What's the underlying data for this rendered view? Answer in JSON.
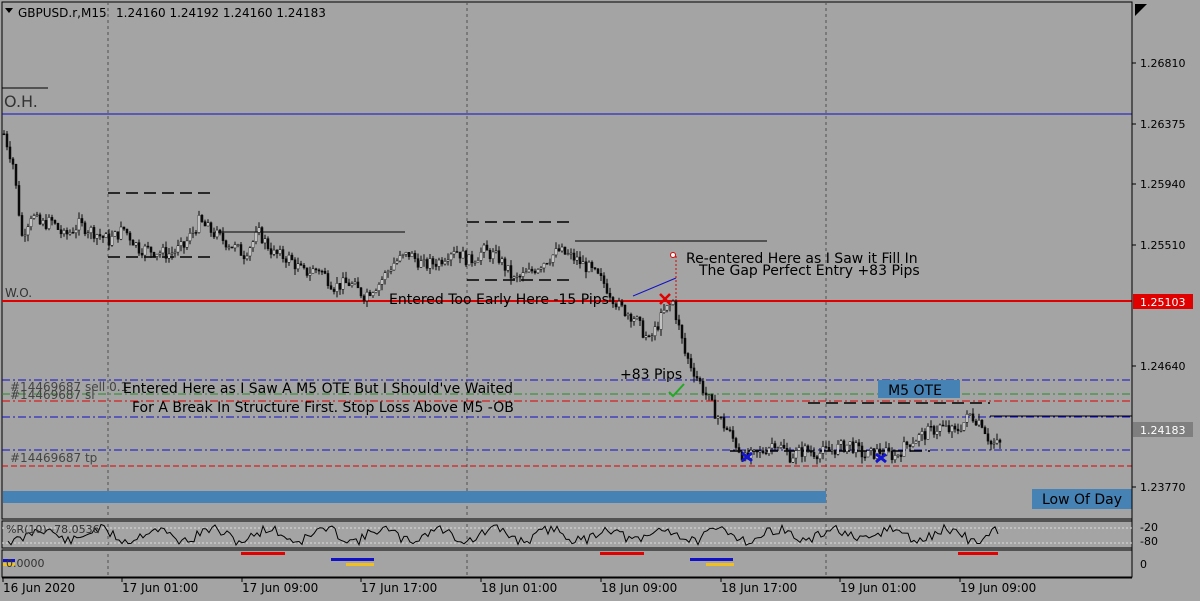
{
  "header": {
    "symbol": "GBPUSD.r,M15",
    "ohlc": "1.24160 1.24192 1.24160 1.24183"
  },
  "chart_data": {
    "type": "candlestick",
    "ylim": [
      1.2367,
      1.272
    ],
    "price_ticks": [
      "1.26810",
      "1.26375",
      "1.25940",
      "1.25510",
      "1.25103",
      "1.24640",
      "1.24183",
      "1.23770"
    ],
    "x_ticks": [
      "16 Jun 2020",
      "17 Jun 01:00",
      "17 Jun 09:00",
      "17 Jun 17:00",
      "18 Jun 01:00",
      "18 Jun 09:00",
      "18 Jun 17:00",
      "19 Jun 01:00",
      "19 Jun 09:00"
    ],
    "current_price": "1.24183",
    "marked_price": "1.25103",
    "close_path": [
      [
        0,
        1.263
      ],
      [
        3,
        1.261
      ],
      [
        6,
        1.256
      ],
      [
        9,
        1.2575
      ],
      [
        12,
        1.2568
      ],
      [
        16,
        1.257
      ],
      [
        20,
        1.256
      ],
      [
        25,
        1.2568
      ],
      [
        30,
        1.2563
      ],
      [
        35,
        1.2557
      ],
      [
        40,
        1.2565
      ],
      [
        45,
        1.2552
      ],
      [
        50,
        1.255
      ],
      [
        55,
        1.2548
      ],
      [
        60,
        1.2553
      ],
      [
        65,
        1.257
      ],
      [
        70,
        1.2562
      ],
      [
        75,
        1.2555
      ],
      [
        80,
        1.2548
      ],
      [
        85,
        1.2562
      ],
      [
        90,
        1.2548
      ],
      [
        95,
        1.2545
      ],
      [
        100,
        1.2535
      ],
      [
        105,
        1.2538
      ],
      [
        110,
        1.2526
      ],
      [
        115,
        1.2528
      ],
      [
        120,
        1.252
      ],
      [
        125,
        1.2528
      ],
      [
        130,
        1.2542
      ],
      [
        135,
        1.2548
      ],
      [
        140,
        1.254
      ],
      [
        145,
        1.2543
      ],
      [
        150,
        1.2552
      ],
      [
        155,
        1.2543
      ],
      [
        160,
        1.255
      ],
      [
        165,
        1.2545
      ],
      [
        170,
        1.253
      ],
      [
        175,
        1.2535
      ],
      [
        180,
        1.2543
      ],
      [
        185,
        1.255
      ],
      [
        190,
        1.2545
      ],
      [
        195,
        1.2538
      ],
      [
        200,
        1.2528
      ],
      [
        205,
        1.2512
      ],
      [
        210,
        1.2505
      ],
      [
        215,
        1.2488
      ],
      [
        220,
        1.2508
      ],
      [
        223,
        1.2515
      ],
      [
        227,
        1.248
      ],
      [
        232,
        1.246
      ],
      [
        237,
        1.244
      ],
      [
        242,
        1.2425
      ],
      [
        247,
        1.2408
      ],
      [
        252,
        1.2412
      ],
      [
        257,
        1.242
      ],
      [
        262,
        1.241
      ],
      [
        267,
        1.2414
      ],
      [
        272,
        1.2412
      ],
      [
        277,
        1.2415
      ],
      [
        282,
        1.2418
      ],
      [
        287,
        1.241
      ],
      [
        292,
        1.2413
      ],
      [
        297,
        1.241
      ],
      [
        302,
        1.242
      ],
      [
        307,
        1.2425
      ],
      [
        312,
        1.243
      ],
      [
        317,
        1.2426
      ],
      [
        322,
        1.2438
      ],
      [
        326,
        1.2433
      ],
      [
        329,
        1.2418
      ],
      [
        332,
        1.2418
      ]
    ],
    "williams_r": {
      "label": "%R(10) -78.0536",
      "levels": [
        "-20",
        "-80"
      ]
    },
    "oscillator_label": "0.0000"
  },
  "annotations": {
    "oh": "O.H.",
    "wo": "W.O.",
    "sell_order": "#14469687 sell 0.1",
    "sl_order": "#14469687 sl",
    "tp_order": "#14469687 tp",
    "reentered_1": "Re-entered Here as I Saw it Fill In",
    "reentered_2": "The Gap Perfect Entry +83 Pips",
    "early": "Entered Too Early Here -15 Pips",
    "plus83": "+83 Pips",
    "entered_1": "Entered Here as I Saw A M5 OTE But I Should've Waited",
    "entered_2": "For A Break In Structure First. Stop Loss Above M5 -OB",
    "m5ote": "M5 OTE",
    "low_of_day": "Low Of Day"
  },
  "colors": {
    "background": "#a4a4a4",
    "bull": "#0a0a0a",
    "bear": "#0a0a0a",
    "blue_line": "#1010c8",
    "red_line": "#e00000",
    "steel_blue": "#4682b4",
    "price_box": "#7f7f7f"
  }
}
